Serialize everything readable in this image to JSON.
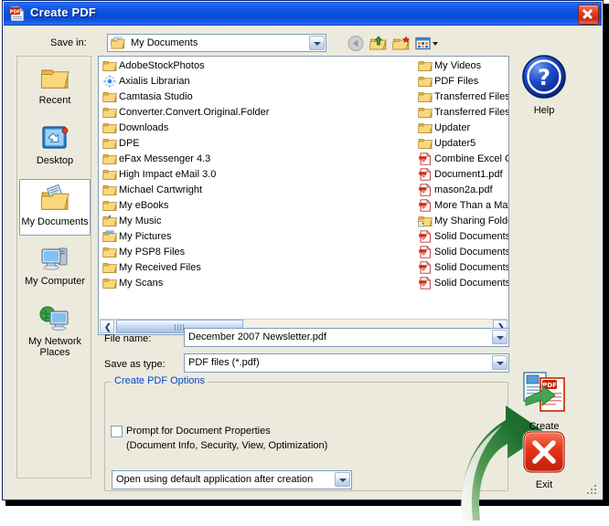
{
  "window": {
    "title": "Create PDF",
    "title_icon": "pdf-document-icon",
    "close_label": "×",
    "colors": {
      "titlebar_blue": "#0a52d8",
      "client_bg": "#eceadd",
      "group_title": "#0046c8",
      "accent_red": "#cc2200",
      "accent_green": "#2e7d32"
    }
  },
  "toolbar": {
    "save_in_label": "Save in:",
    "save_in_value": "My Documents",
    "save_in_icon": "my-documents-folder-icon",
    "buttons": [
      {
        "name": "back",
        "icon": "back-arrow-icon",
        "label": "Back"
      },
      {
        "name": "up-one-level",
        "icon": "up-folder-icon",
        "label": "Up One Level"
      },
      {
        "name": "create-new-folder",
        "icon": "new-folder-icon",
        "label": "Create New Folder"
      },
      {
        "name": "views",
        "icon": "views-icon",
        "label": "Views"
      }
    ]
  },
  "places": [
    {
      "label": "Recent",
      "icon": "recent-folder-icon",
      "selected": false
    },
    {
      "label": "Desktop",
      "icon": "desktop-icon",
      "selected": false
    },
    {
      "label": "My Documents",
      "icon": "my-documents-icon",
      "selected": true
    },
    {
      "label": "My Computer",
      "icon": "my-computer-icon",
      "selected": false
    },
    {
      "label": "My Network Places",
      "icon": "my-network-places-icon",
      "selected": false
    }
  ],
  "filelist": {
    "column1": [
      {
        "name": "AdobeStockPhotos",
        "icon": "folder-icon"
      },
      {
        "name": "Axialis Librarian",
        "icon": "axialis-app-icon"
      },
      {
        "name": "Camtasia Studio",
        "icon": "folder-icon"
      },
      {
        "name": "Converter.Convert.Original.Folder",
        "icon": "folder-icon"
      },
      {
        "name": "Downloads",
        "icon": "folder-icon"
      },
      {
        "name": "DPE",
        "icon": "folder-icon"
      },
      {
        "name": "eFax Messenger 4.3",
        "icon": "folder-icon"
      },
      {
        "name": "High Impact eMail 3.0",
        "icon": "folder-icon"
      },
      {
        "name": "Michael Cartwright",
        "icon": "folder-icon"
      },
      {
        "name": "My eBooks",
        "icon": "folder-icon"
      },
      {
        "name": "My Music",
        "icon": "my-music-folder-icon"
      },
      {
        "name": "My Pictures",
        "icon": "my-pictures-folder-icon"
      },
      {
        "name": "My PSP8 Files",
        "icon": "folder-icon"
      },
      {
        "name": "My Received Files",
        "icon": "folder-icon"
      },
      {
        "name": "My Scans",
        "icon": "folder-icon"
      }
    ],
    "column2": [
      {
        "name": "My Videos",
        "icon": "folder-icon"
      },
      {
        "name": "PDF Files",
        "icon": "folder-icon"
      },
      {
        "name": "Transferred Files",
        "icon": "folder-icon"
      },
      {
        "name": "Transferred Files",
        "icon": "folder-icon"
      },
      {
        "name": "Updater",
        "icon": "folder-icon"
      },
      {
        "name": "Updater5",
        "icon": "folder-icon"
      },
      {
        "name": "Combine Excel Co",
        "icon": "pdf-file-icon"
      },
      {
        "name": "Document1.pdf",
        "icon": "pdf-file-icon"
      },
      {
        "name": "mason2a.pdf",
        "icon": "pdf-file-icon"
      },
      {
        "name": "More Than a Matt",
        "icon": "pdf-file-icon"
      },
      {
        "name": "My Sharing Folder",
        "icon": "shared-folder-icon"
      },
      {
        "name": "Solid Documents F",
        "icon": "pdf-file-icon"
      },
      {
        "name": "Solid Documents F",
        "icon": "pdf-file-icon"
      },
      {
        "name": "Solid Documents F",
        "icon": "pdf-file-icon"
      },
      {
        "name": "Solid Documents F",
        "icon": "pdf-file-icon"
      }
    ],
    "scrollbar": {
      "left_arrow": "❮",
      "right_arrow": "❯"
    }
  },
  "fields": {
    "filename_label": "File name:",
    "filename_value": "December 2007 Newsletter.pdf",
    "savetype_label": "Save as type:",
    "savetype_value": "PDF files (*.pdf)"
  },
  "options": {
    "group_title": "Create PDF Options",
    "prompt_label": "Prompt for Document Properties",
    "prompt_checked": false,
    "prompt_sub": "(Document Info, Security, View, Optimization)",
    "open_action_value": "Open using default application after creation"
  },
  "actions": [
    {
      "label": "Help",
      "icon": "help-question-icon"
    },
    {
      "label": "Create",
      "icon": "create-pdf-icon"
    },
    {
      "label": "Exit",
      "icon": "exit-x-icon"
    }
  ]
}
